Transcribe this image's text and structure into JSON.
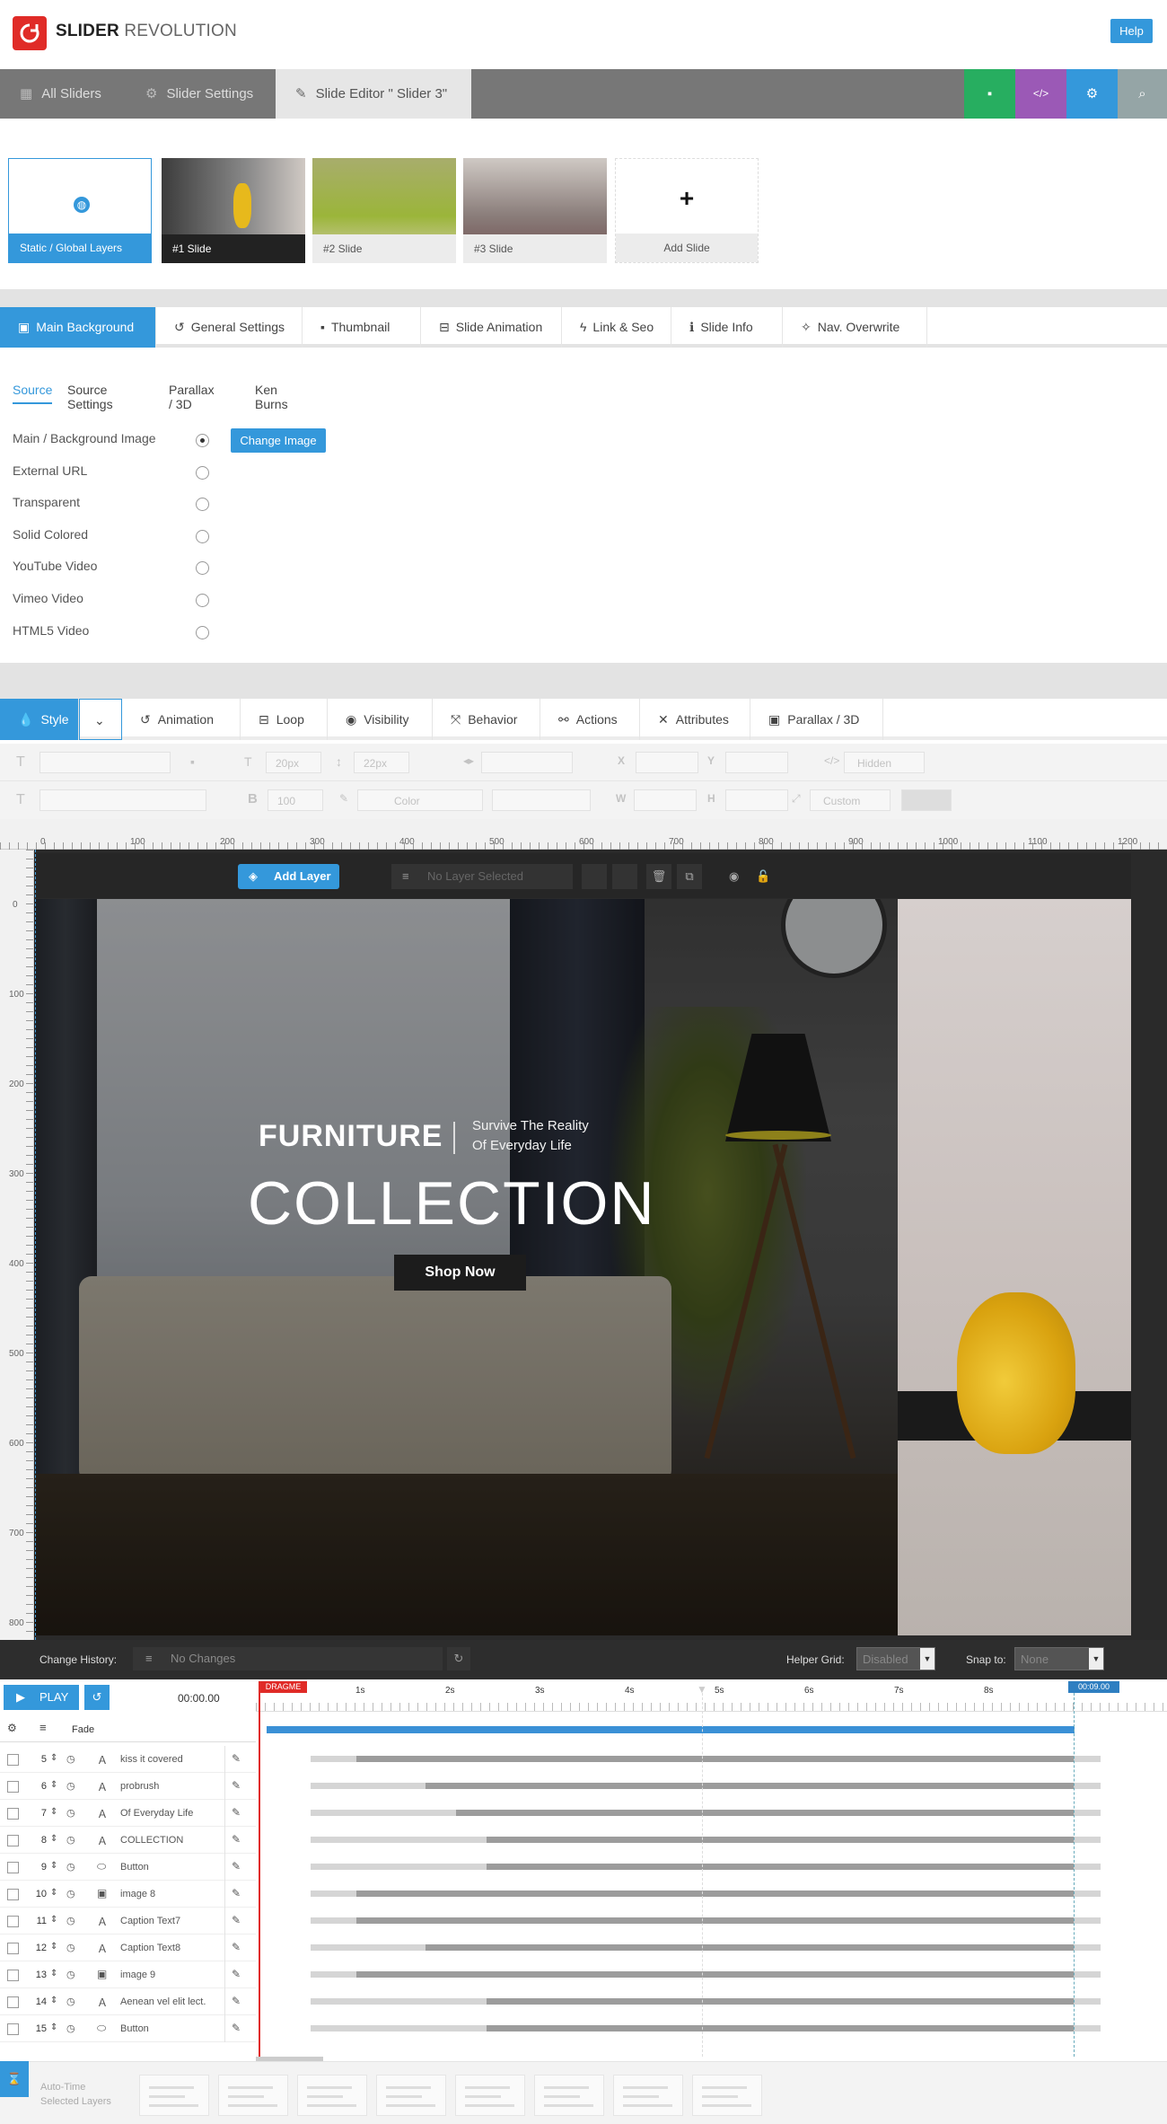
{
  "header": {
    "brand_bold": "SLIDER",
    "brand_light": " REVOLUTION",
    "help": "Help"
  },
  "topnav": {
    "items": [
      {
        "icon": "grid-icon",
        "label": "All Sliders"
      },
      {
        "icon": "gear-icon",
        "label": "Slider Settings"
      },
      {
        "icon": "pencil-icon",
        "label": "Slide Editor \" Slider 3\""
      }
    ],
    "actions": [
      {
        "icon": "save-icon",
        "color": "#27ae60"
      },
      {
        "icon": "code-icon",
        "color": "#9b59b6"
      },
      {
        "icon": "gear-icon",
        "color": "#3498db"
      },
      {
        "icon": "search-icon",
        "color": "#95a5a6"
      }
    ]
  },
  "slides": [
    {
      "label": "Static / Global Layers"
    },
    {
      "label": "#1 Slide"
    },
    {
      "label": "#2 Slide"
    },
    {
      "label": "#3 Slide"
    },
    {
      "label": "Add Slide"
    }
  ],
  "tabs1": [
    "Main Background",
    "General Settings",
    "Thumbnail",
    "Slide Animation",
    "Link & Seo",
    "Slide Info",
    "Nav. Overwrite"
  ],
  "subtabs": [
    "Source",
    "Source Settings",
    "Parallax / 3D",
    "Ken Burns"
  ],
  "sources": [
    "Main / Background Image",
    "External URL",
    "Transparent",
    "Solid Colored",
    "YouTube Video",
    "Vimeo Video",
    "HTML5 Video"
  ],
  "change_image": "Change Image",
  "tabs2": [
    "Style",
    "",
    "Animation",
    "Loop",
    "Visibility",
    "Behavior",
    "Actions",
    "Attributes",
    "Parallax / 3D"
  ],
  "toolbar": {
    "fontsize": "20px",
    "lineheight": "22px",
    "x": "X",
    "y": "Y",
    "hidden": "Hidden",
    "weight": "100",
    "color": "Color",
    "w": "W",
    "h": "H",
    "custom": "Custom"
  },
  "ruler_x": [
    "0",
    "100",
    "200",
    "300",
    "400",
    "500",
    "600",
    "700",
    "800",
    "900",
    "1000",
    "1100",
    "1200"
  ],
  "ruler_y": [
    "0",
    "100",
    "200",
    "300",
    "400",
    "500",
    "600",
    "700",
    "800"
  ],
  "canvas": {
    "add_layer": "Add Layer",
    "no_layer": "No Layer Selected"
  },
  "hero": {
    "furniture": "FURNITURE",
    "line1": "Survive The Reality",
    "line2": "Of Everyday Life",
    "collection": "COLLECTION",
    "button": "Shop Now"
  },
  "history": {
    "label": "Change History:",
    "value": "No Changes",
    "helper_label": "Helper Grid:",
    "helper_value": "Disabled",
    "snap_label": "Snap to:",
    "snap_value": "None"
  },
  "timeline": {
    "play": "PLAY",
    "time": "00:00.00",
    "dragme": "DRAGME",
    "endtime": "00:09.00",
    "fade": "Fade",
    "ticks": [
      "1s",
      "2s",
      "3s",
      "4s",
      "5s",
      "6s",
      "7s",
      "8s"
    ],
    "layers": [
      {
        "num": "5",
        "type": "A",
        "name": "kiss it covered",
        "start": 0.06
      },
      {
        "num": "6",
        "type": "A",
        "name": "probrush",
        "start": 0.15
      },
      {
        "num": "7",
        "type": "A",
        "name": "Of Everyday Life",
        "start": 0.19
      },
      {
        "num": "8",
        "type": "A",
        "name": "COLLECTION",
        "start": 0.23
      },
      {
        "num": "9",
        "type": "btn",
        "name": "Button",
        "start": 0.23
      },
      {
        "num": "10",
        "type": "img",
        "name": "image 8",
        "start": 0.06
      },
      {
        "num": "11",
        "type": "A",
        "name": "Caption Text7",
        "start": 0.06
      },
      {
        "num": "12",
        "type": "A",
        "name": "Caption Text8",
        "start": 0.15
      },
      {
        "num": "13",
        "type": "img",
        "name": "image 9",
        "start": 0.06
      },
      {
        "num": "14",
        "type": "A",
        "name": "Aenean vel elit lect.",
        "start": 0.23
      },
      {
        "num": "15",
        "type": "btn",
        "name": "Button",
        "start": 0.23
      }
    ]
  },
  "bottom": {
    "auto_time": "Auto-Time",
    "selected_layers": "Selected Layers"
  }
}
